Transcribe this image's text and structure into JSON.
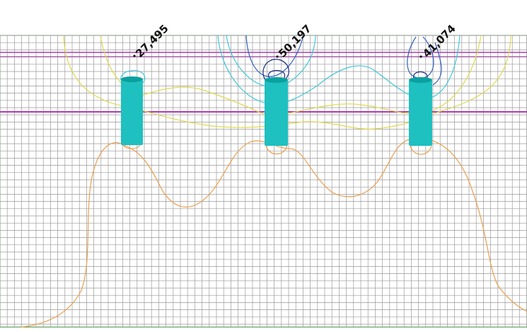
{
  "view": {
    "grid_visible": true,
    "colors": {
      "background": "#ffffff",
      "grid": "#9a9a9a",
      "grid_border": "#3a8a3a",
      "reference_lines": "#b03ab0",
      "well": "#1ec0c0",
      "well_edge": "#0aa0a0",
      "contour_outer": "#e8a050",
      "contour_mid": "#e0d850",
      "contour_cyan": "#40c8d8",
      "contour_blue": "#3060c0",
      "contour_navy": "#1a2a80"
    }
  },
  "wells": [
    {
      "id": "well-1",
      "label": "27,495"
    },
    {
      "id": "well-2",
      "label": "50,197"
    },
    {
      "id": "well-3",
      "label": "41,074"
    }
  ]
}
